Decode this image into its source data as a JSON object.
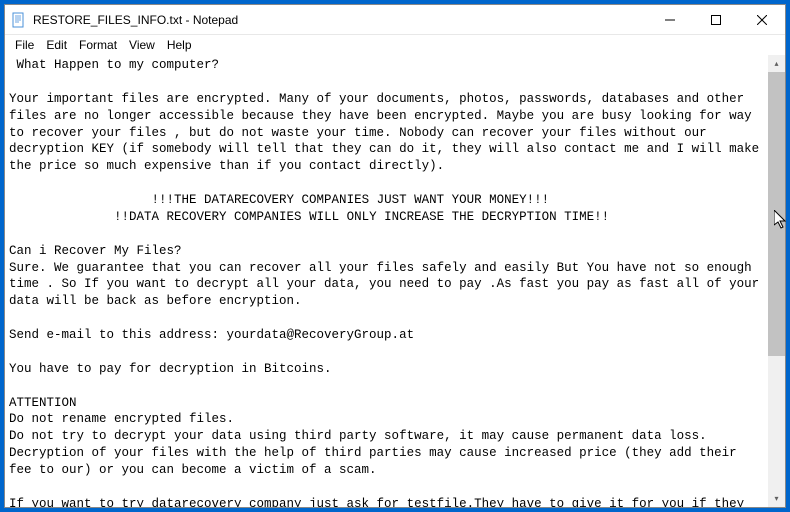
{
  "titlebar": {
    "title": "RESTORE_FILES_INFO.txt - Notepad"
  },
  "window_controls": {
    "minimize": "–",
    "maximize": "□",
    "close": "✕"
  },
  "menubar": {
    "file": "File",
    "edit": "Edit",
    "format": "Format",
    "view": "View",
    "help": "Help"
  },
  "content": {
    "text": " What Happen to my computer?\n\nYour important files are encrypted. Many of your documents, photos, passwords, databases and other files are no longer accessible because they have been encrypted. Maybe you are busy looking for way to recover your files , but do not waste your time. Nobody can recover your files without our decryption KEY (if somebody will tell that they can do it, they will also contact me and I will make the price so much expensive than if you contact directly).\n\n                   !!!THE DATARECOVERY COMPANIES JUST WANT YOUR MONEY!!!\n              !!DATA RECOVERY COMPANIES WILL ONLY INCREASE THE DECRYPTION TIME!!\n\nCan i Recover My Files?\nSure. We guarantee that you can recover all your files safely and easily But You have not so enough time . So If you want to decrypt all your data, you need to pay .As fast you pay as fast all of your data will be back as before encryption.\n\nSend e-mail to this address: yourdata@RecoveryGroup.at\n\nYou have to pay for decryption in Bitcoins.\n\nATTENTION\nDo not rename encrypted files.\nDo not try to decrypt your data using third party software, it may cause permanent data loss.\nDecryption of your files with the help of third parties may cause increased price (they add their fee to our) or you can become a victim of a scam.\n\nIf you want to try datarecovery company just ask for testfile.They have to give it for you if they can do something."
  },
  "scrollbar": {
    "up": "▴",
    "down": "▾"
  }
}
